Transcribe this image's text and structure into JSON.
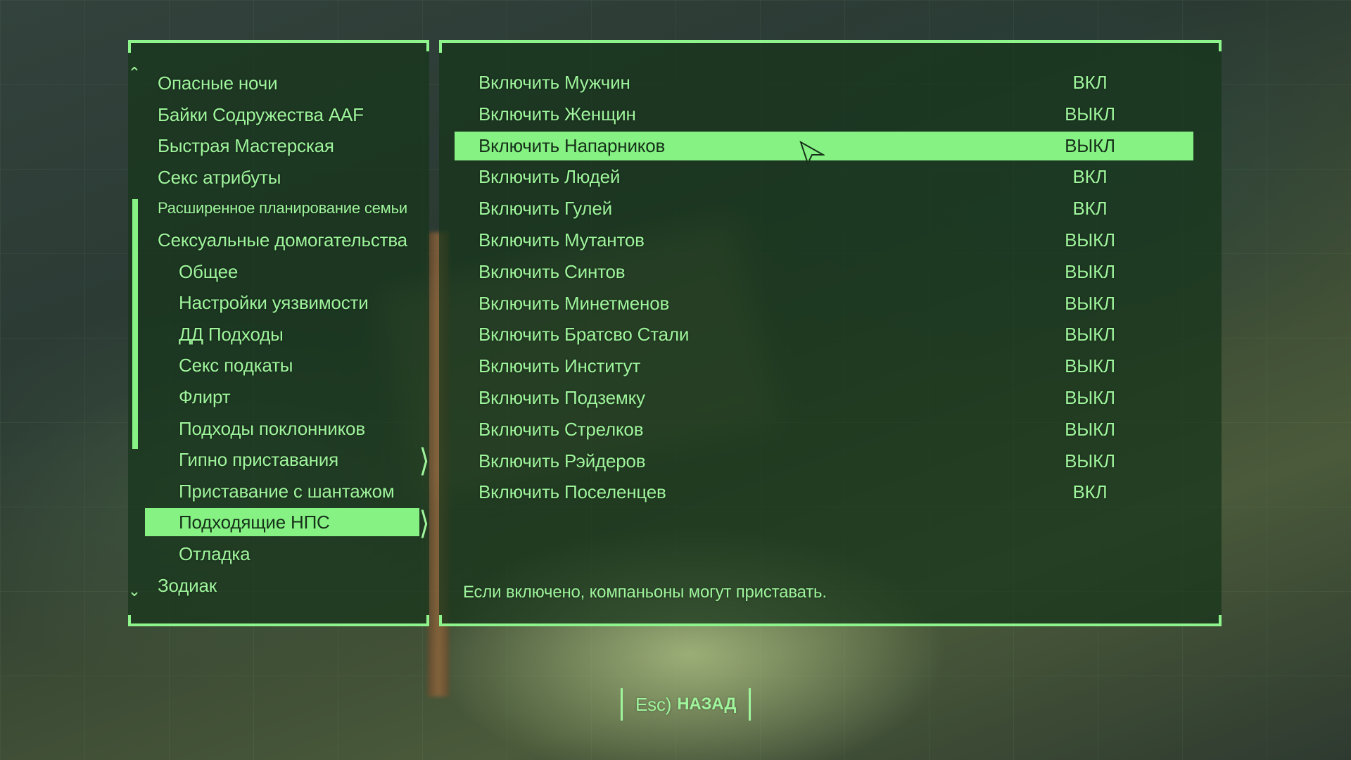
{
  "left_menu": {
    "items": [
      {
        "label": "Опасные ночи",
        "indent": 0
      },
      {
        "label": "Байки Содружества AAF",
        "indent": 0
      },
      {
        "label": "Быстрая Мастерская",
        "indent": 0
      },
      {
        "label": "Секс атрибуты",
        "indent": 0
      },
      {
        "label": "Расширенное планирование семьи",
        "indent": 0,
        "small": true
      },
      {
        "label": "Сексуальные домогательства",
        "indent": 0
      },
      {
        "label": "Общее",
        "indent": 1
      },
      {
        "label": "Настройки уязвимости",
        "indent": 1
      },
      {
        "label": "ДД Подходы",
        "indent": 1
      },
      {
        "label": "Секс подкаты",
        "indent": 1
      },
      {
        "label": "Флирт",
        "indent": 1
      },
      {
        "label": "Подходы поклонников",
        "indent": 1
      },
      {
        "label": "Гипно приставания",
        "indent": 1
      },
      {
        "label": "Приставание с шантажом",
        "indent": 1
      },
      {
        "label": "Подходящие НПС",
        "indent": 1,
        "selected": true
      },
      {
        "label": "Отладка",
        "indent": 1
      },
      {
        "label": "Зодиак",
        "indent": 0
      }
    ]
  },
  "options": {
    "rows": [
      {
        "label": "Включить Мужчин",
        "value": "ВКЛ"
      },
      {
        "label": "Включить Женщин",
        "value": "ВЫКЛ"
      },
      {
        "label": "Включить Напарников",
        "value": "ВЫКЛ",
        "selected": true
      },
      {
        "label": "Включить Людей",
        "value": "ВКЛ"
      },
      {
        "label": "Включить Гулей",
        "value": "ВКЛ"
      },
      {
        "label": "Включить Мутантов",
        "value": "ВЫКЛ"
      },
      {
        "label": "Включить Синтов",
        "value": "ВЫКЛ"
      },
      {
        "label": "Включить Минетменов",
        "value": "ВЫКЛ"
      },
      {
        "label": "Включить Братсво Стали",
        "value": "ВЫКЛ"
      },
      {
        "label": "Включить Институт",
        "value": "ВЫКЛ"
      },
      {
        "label": "Включить Подземку",
        "value": "ВЫКЛ"
      },
      {
        "label": "Включить Стрелков",
        "value": "ВЫКЛ"
      },
      {
        "label": "Включить Рэйдеров",
        "value": "ВЫКЛ"
      },
      {
        "label": "Включить Поселенцев",
        "value": "ВКЛ"
      }
    ]
  },
  "description": "Если включено, компаньоны могут приставать.",
  "back_button": {
    "key": "Esc)",
    "label": "НАЗАД"
  },
  "colors": {
    "accent": "#86f283",
    "text": "#9ff59c",
    "panel": "#16341a"
  }
}
